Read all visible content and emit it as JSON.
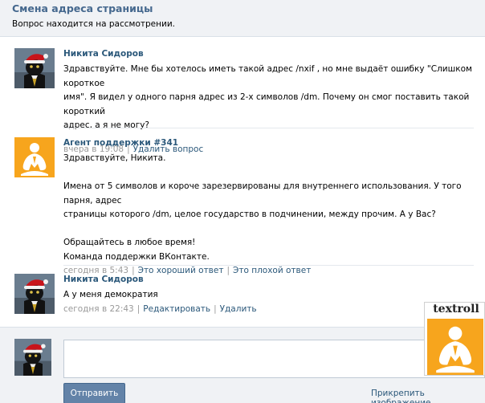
{
  "header": {
    "title": "Смена адреса страницы",
    "status": "Вопрос находится на рассмотрении."
  },
  "messages": [
    {
      "author": "Никита Сидоров",
      "avatar_icon": "cat-santa-avatar",
      "lines": [
        "Здравствуйте. Мне бы хотелось иметь такой адрес /nxif , но мне выдаёт ошибку \"Слишком короткое",
        "имя\". Я видел у одного парня адрес из 2-х символов /dm. Почему он смог поставить такой короткий",
        "адрес, а я не могу?"
      ],
      "time": "вчера в 19:08",
      "actions": [
        "Удалить вопрос"
      ]
    },
    {
      "author": "Агент поддержки #341",
      "avatar_icon": "support-agent-avatar",
      "lines": [
        "Здравствуйте, Никита.",
        "",
        "Имена от 5 символов и короче зарезервированы для внутреннего использования. У того парня, адрес",
        "страницы которого /dm, целое государство в подчинении, между прочим. А у Вас?",
        "",
        "Обращайтесь в любое время!",
        "Команда поддержки ВКонтакте."
      ],
      "time": "сегодня в 5:43",
      "actions": [
        "Это хороший ответ",
        "Это плохой ответ"
      ]
    },
    {
      "author": "Никита Сидоров",
      "avatar_icon": "cat-santa-avatar",
      "lines": [
        "А у меня демократия"
      ],
      "time": "сегодня в 22:43",
      "actions": [
        "Редактировать",
        "Удалить"
      ]
    }
  ],
  "reply": {
    "send_label": "Отправить",
    "attach_label": "Прикрепить изображение"
  },
  "watermark": {
    "text": "textroll"
  },
  "colors": {
    "link": "#2b587a",
    "title": "#45688e",
    "button": "#6383a8",
    "agent_avatar_bg": "#f7a51d"
  }
}
